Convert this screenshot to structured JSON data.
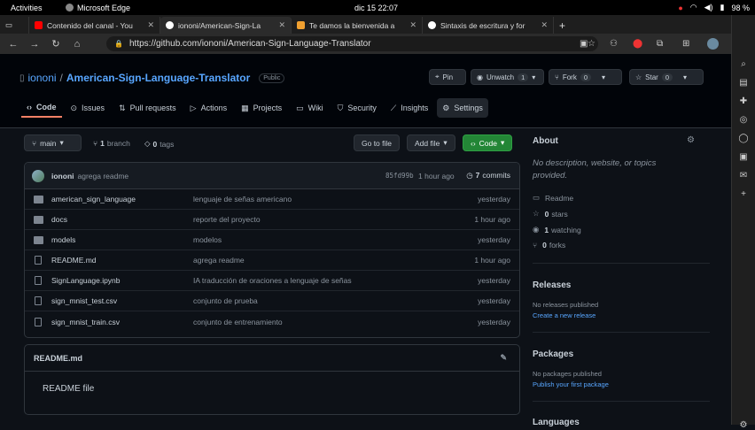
{
  "os": {
    "activities": "Activities",
    "app_name": "Microsoft Edge",
    "clock": "dic 15  22:07",
    "battery": "98 %"
  },
  "tabs": [
    {
      "label": "Contenido del canal - You",
      "color": "#ff0000"
    },
    {
      "label": "iononi/American-Sign-La",
      "color": "#ffffff"
    },
    {
      "label": "Te damos la bienvenida a",
      "color": "#f0a030"
    },
    {
      "label": "Sintaxis de escritura y for",
      "color": "#ffffff"
    }
  ],
  "browser": {
    "url": "https://github.com/iononi/American-Sign-Language-Translator"
  },
  "repo": {
    "owner": "iononi",
    "separator": "/",
    "name": "American-Sign-Language-Translator",
    "visibility": "Public",
    "pin": "Pin",
    "unwatch": "Unwatch",
    "unwatch_count": "1",
    "fork": "Fork",
    "fork_count": "0",
    "star": "Star",
    "star_count": "0"
  },
  "repo_tabs": [
    {
      "label": "Code",
      "icon": "code-icon"
    },
    {
      "label": "Issues",
      "icon": "issue-icon"
    },
    {
      "label": "Pull requests",
      "icon": "pull-request-icon"
    },
    {
      "label": "Actions",
      "icon": "actions-icon"
    },
    {
      "label": "Projects",
      "icon": "projects-icon"
    },
    {
      "label": "Wiki",
      "icon": "wiki-icon"
    },
    {
      "label": "Security",
      "icon": "shield-icon"
    },
    {
      "label": "Insights",
      "icon": "graph-icon"
    },
    {
      "label": "Settings",
      "icon": "gear-icon"
    }
  ],
  "toolbar": {
    "branch": "main",
    "branches_count": "1",
    "branches_label": "branch",
    "tags_count": "0",
    "tags_label": "tags",
    "goto_file": "Go to file",
    "add_file": "Add file",
    "code": "Code"
  },
  "commit": {
    "author": "iononi",
    "message": "agrega readme",
    "hash": "85fd99b",
    "time": "1 hour ago",
    "count": "7",
    "count_label": "commits"
  },
  "files": [
    {
      "name": "american_sign_language",
      "type": "folder",
      "message": "lenguaje de señas americano",
      "date": "yesterday"
    },
    {
      "name": "docs",
      "type": "folder",
      "message": "reporte del proyecto",
      "date": "1 hour ago"
    },
    {
      "name": "models",
      "type": "folder",
      "message": "modelos",
      "date": "yesterday"
    },
    {
      "name": "README.md",
      "type": "file",
      "message": "agrega readme",
      "date": "1 hour ago"
    },
    {
      "name": "SignLanguage.ipynb",
      "type": "file",
      "message": "IA traducción de oraciones a lenguaje de señas",
      "date": "yesterday"
    },
    {
      "name": "sign_mnist_test.csv",
      "type": "file",
      "message": "conjunto de prueba",
      "date": "yesterday"
    },
    {
      "name": "sign_mnist_train.csv",
      "type": "file",
      "message": "conjunto de entrenamiento",
      "date": "yesterday"
    }
  ],
  "readme": {
    "title": "README.md",
    "body": "README file"
  },
  "sidebar": {
    "about_title": "About",
    "about_text": "No description, website, or topics provided.",
    "readme_link": "Readme",
    "stars_count": "0",
    "stars_label": "stars",
    "watching_count": "1",
    "watching_label": "watching",
    "forks_count": "0",
    "forks_label": "forks",
    "releases_title": "Releases",
    "releases_none": "No releases published",
    "releases_link": "Create a new release",
    "packages_title": "Packages",
    "packages_none": "No packages published",
    "packages_link": "Publish your first package",
    "languages_title": "Languages"
  }
}
